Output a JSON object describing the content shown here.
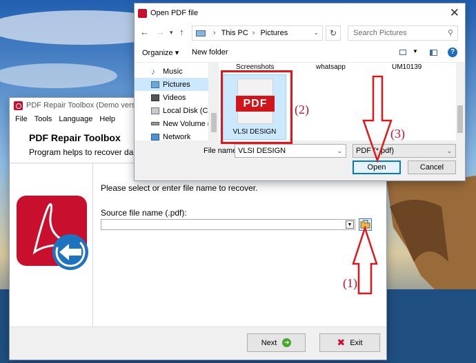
{
  "desktop": {
    "sky_top": "#2f76c8",
    "sky_mid": "#9cc4e8",
    "sea": "#1b4e87",
    "rocks": "#b88a4e"
  },
  "app": {
    "title": "PDF Repair Toolbox (Demo version)",
    "menu": [
      "File",
      "Tools",
      "Language",
      "Help"
    ],
    "heading": "PDF Repair Toolbox",
    "subheading": "Program helps to recover damaged files in Adobe Acrobat (*.pdf) format",
    "prompt": "Please select or enter file name to recover.",
    "source_label": "Source file name (.pdf):",
    "source_value": "",
    "next_label": "Next",
    "exit_label": "Exit",
    "brand_color": "#c8102e"
  },
  "dialog": {
    "title": "Open PDF file",
    "breadcrumb": [
      "This PC",
      "Pictures"
    ],
    "search_placeholder": "Search Pictures",
    "organize_label": "Organize",
    "new_folder_label": "New folder",
    "nav_items": [
      {
        "label": "Music",
        "icon": "music-note-icon"
      },
      {
        "label": "Pictures",
        "icon": "pictures-folder-icon",
        "selected": true
      },
      {
        "label": "Videos",
        "icon": "videos-folder-icon"
      },
      {
        "label": "Local Disk (C:)",
        "icon": "local-disk-icon"
      },
      {
        "label": "New Volume (D:)",
        "icon": "drive-icon"
      },
      {
        "label": "Network",
        "icon": "network-icon"
      }
    ],
    "files": [
      {
        "name": "Screenshots"
      },
      {
        "name": "whatsapp"
      },
      {
        "name": "UM10139"
      },
      {
        "name": "VLSI DESIGN",
        "type": "pdf",
        "selected": true,
        "badge": "PDF"
      }
    ],
    "file_name_label": "File name:",
    "file_name_value": "VLSI DESIGN",
    "file_type_value": "PDF (*.pdf)",
    "open_label": "Open",
    "cancel_label": "Cancel"
  },
  "annotations": {
    "step1": "(1)",
    "step2": "(2)",
    "step3": "(3)",
    "color": "#e0161b"
  }
}
